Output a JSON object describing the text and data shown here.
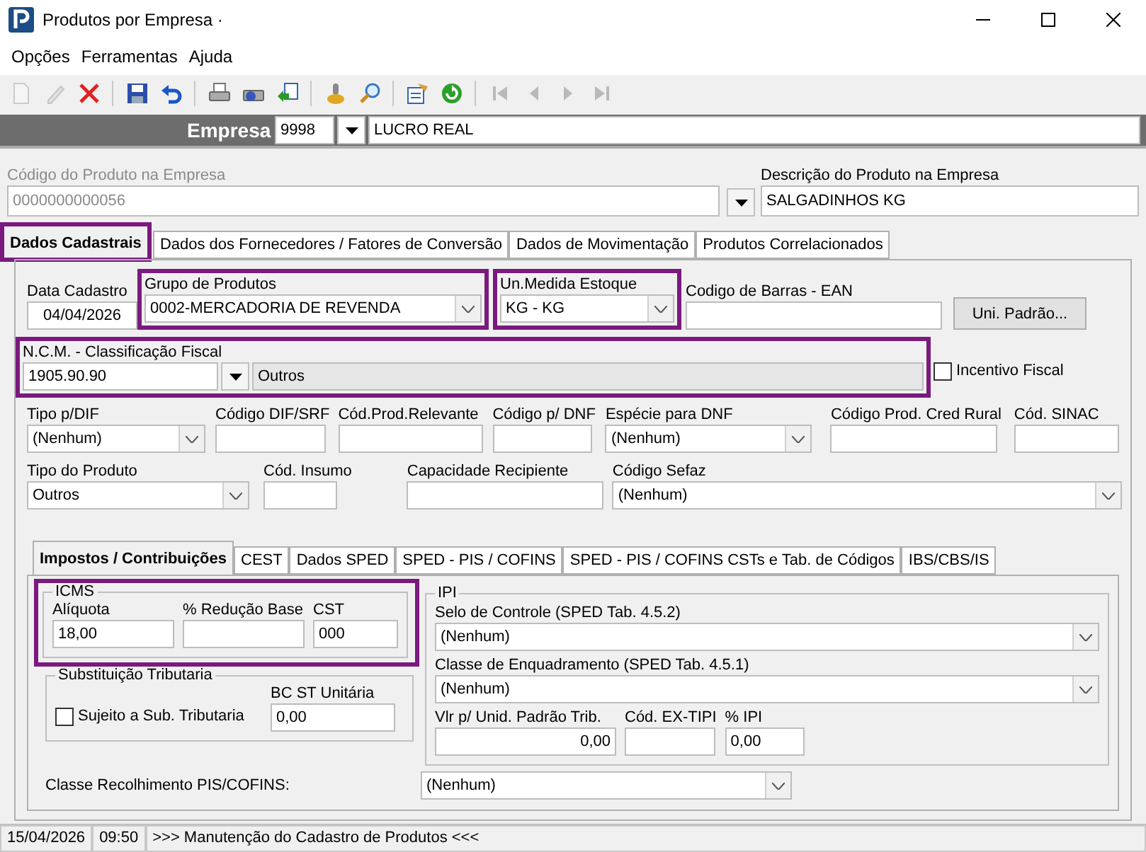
{
  "window": {
    "title": "Produtos por Empresa ·"
  },
  "menu": [
    "Opções",
    "Ferramentas",
    "Ajuda"
  ],
  "toolbar": [
    {
      "kind": "new",
      "disabled": true
    },
    {
      "kind": "edit",
      "disabled": true
    },
    {
      "kind": "delete",
      "disabled": false
    },
    {
      "kind": "separator"
    },
    {
      "kind": "save",
      "disabled": false
    },
    {
      "kind": "undo",
      "disabled": false
    },
    {
      "kind": "separator"
    },
    {
      "kind": "print",
      "disabled": false
    },
    {
      "kind": "print-setup",
      "disabled": false
    },
    {
      "kind": "export",
      "disabled": false
    },
    {
      "kind": "separator"
    },
    {
      "kind": "knob",
      "disabled": false
    },
    {
      "kind": "search",
      "disabled": false
    },
    {
      "kind": "separator"
    },
    {
      "kind": "properties",
      "disabled": false
    },
    {
      "kind": "refresh",
      "disabled": false
    },
    {
      "kind": "separator"
    },
    {
      "kind": "first",
      "disabled": true
    },
    {
      "kind": "prev",
      "disabled": true
    },
    {
      "kind": "next",
      "disabled": true
    },
    {
      "kind": "last",
      "disabled": true
    }
  ],
  "company": {
    "label": "Empresa",
    "code": "9998",
    "name": "LUCRO REAL"
  },
  "product": {
    "code_label": "Código do Produto na Empresa",
    "code": "0000000000056",
    "code_disabled": true,
    "description_label": "Descrição do Produto na Empresa",
    "description": "SALGADINHOS KG"
  },
  "tabs": [
    {
      "label": "Dados Cadastrais",
      "selected": true,
      "highlighted": true
    },
    {
      "label": "Dados dos Fornecedores / Fatores de Conversão",
      "selected": false
    },
    {
      "label": "Dados de Movimentação",
      "selected": false
    },
    {
      "label": "Produtos Correlacionados",
      "selected": false
    }
  ],
  "form": {
    "general": [
      {
        "kind": "date",
        "label": "Data Cadastro",
        "value": "04/04/2026"
      },
      {
        "kind": "select",
        "label": "Grupo de Produtos",
        "value": "0002-MERCADORIA DE REVENDA",
        "highlighted": true
      },
      {
        "kind": "select",
        "label": "Un.Medida Estoque",
        "value": "KG - KG",
        "highlighted": true
      },
      {
        "kind": "text",
        "label": "Codigo de Barras - EAN"
      }
    ],
    "unit_button": "Uni. Padrão...",
    "ncm": {
      "label": "N.C.M. -  Classificação Fiscal",
      "code": "1905.90.90",
      "description": "Outros",
      "highlighted": true
    },
    "incentive": {
      "label": "Incentivo Fiscal",
      "checked": false
    },
    "fiscal": [
      {
        "kind": "select",
        "label": "Tipo p/DIF",
        "value": "(Nenhum)"
      },
      {
        "kind": "text",
        "label": "Código DIF/SRF"
      },
      {
        "kind": "text",
        "label": "Cód.Prod.Relevante"
      },
      {
        "kind": "text",
        "label": "Código p/ DNF"
      },
      {
        "kind": "select",
        "label": "Espécie para DNF",
        "value": "(Nenhum)"
      },
      {
        "kind": "text",
        "label": "Código Prod. Cred Rural"
      },
      {
        "kind": "text",
        "label": "Cód. SINAC"
      }
    ],
    "product_type": [
      {
        "kind": "select",
        "label": "Tipo do Produto",
        "value": "Outros"
      },
      {
        "kind": "text",
        "label": "Cód. Insumo"
      },
      {
        "kind": "text",
        "label": "Capacidade Recipiente"
      },
      {
        "kind": "select",
        "label": "Código Sefaz",
        "value": "(Nenhum)"
      }
    ]
  },
  "taxes": {
    "tabs": [
      {
        "label": "Impostos / Contribuições",
        "selected": true
      },
      {
        "label": "CEST",
        "selected": false
      },
      {
        "label": "Dados SPED",
        "selected": false
      },
      {
        "label": "SPED - PIS / COFINS",
        "selected": false
      },
      {
        "label": "SPED - PIS / COFINS CSTs e Tab. de Códigos",
        "selected": false
      },
      {
        "label": "IBS/CBS/IS",
        "selected": false
      }
    ],
    "icms": {
      "title": "ICMS",
      "highlighted": true,
      "fields": [
        {
          "label": "Alíquota",
          "value": "18,00"
        },
        {
          "label": "% Redução Base"
        },
        {
          "label": "CST",
          "value": "000"
        }
      ]
    },
    "st": {
      "title": "Substituição Tributaria",
      "checkbox": {
        "label": "Sujeito a Sub. Tributaria",
        "checked": false
      },
      "field": {
        "label": "BC ST Unitária",
        "value": "0,00"
      }
    },
    "ipi": {
      "title": "IPI",
      "selects": [
        {
          "label": "Selo de Controle (SPED Tab. 4.5.2)",
          "value": "(Nenhum)"
        },
        {
          "label": "Classe de Enquadramento (SPED Tab. 4.5.1)",
          "value": "(Nenhum)"
        }
      ],
      "fields": [
        {
          "label": "Vlr p/ Unid. Padrão Trib.",
          "value": "0,00",
          "kind": "number"
        },
        {
          "label": "Cód. EX-TIPI",
          "kind": "text"
        },
        {
          "label": "% IPI",
          "value": "0,00",
          "kind": "text"
        }
      ]
    },
    "pis": {
      "label": "Classe Recolhimento PIS/COFINS:",
      "value": "(Nenhum)"
    }
  },
  "status": [
    "15/04/2026",
    "09:50",
    ">>> Manutenção do Cadastro de Produtos <<<"
  ]
}
